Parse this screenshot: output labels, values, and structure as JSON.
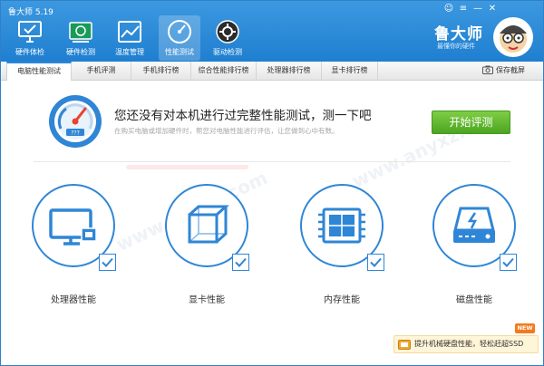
{
  "app": {
    "title": "鲁大师 5.19"
  },
  "window_controls": {
    "skin": "☺",
    "menu": "≡",
    "minimize": "—",
    "close": "✕"
  },
  "nav": [
    {
      "label": "硬件体检",
      "icon": "monitor-check-icon"
    },
    {
      "label": "硬件检测",
      "icon": "circuit-board-icon"
    },
    {
      "label": "温度管理",
      "icon": "temperature-chart-icon"
    },
    {
      "label": "性能测试",
      "icon": "speedometer-icon",
      "active": true
    },
    {
      "label": "驱动检测",
      "icon": "gear-disc-icon"
    }
  ],
  "brand": {
    "name": "鲁大师",
    "slogan": "最懂你的硬件",
    "avatar_icon": "mascot-avatar-icon"
  },
  "tabs": [
    {
      "label": "电脑性能测试",
      "active": true
    },
    {
      "label": "手机评测"
    },
    {
      "label": "手机排行榜"
    },
    {
      "label": "综合性能排行榜"
    },
    {
      "label": "处理器排行榜"
    },
    {
      "label": "显卡排行榜"
    }
  ],
  "screenshot": {
    "label": "保存截屏",
    "icon": "camera-icon"
  },
  "main": {
    "headline": "您还没有对本机进行过完整性能测试，测一下吧",
    "subtext": "在购买电脑或增加硬件时，帮您对电脑性能进行评估，让您做到心中有数。",
    "gauge_readout": "???",
    "start_button": "开始评测"
  },
  "cards": [
    {
      "label": "处理器性能",
      "icon": "cpu-monitor-icon",
      "checked": true
    },
    {
      "label": "显卡性能",
      "icon": "gpu-cube-icon",
      "checked": true
    },
    {
      "label": "内存性能",
      "icon": "memory-chip-icon",
      "checked": true
    },
    {
      "label": "磁盘性能",
      "icon": "hard-disk-icon",
      "checked": true
    }
  ],
  "promo": {
    "text": "提升机械硬盘性能，轻松赶超SSD",
    "badge": "NEW",
    "icon": "ssd-icon"
  },
  "watermark": "www.anyxz.com",
  "colors": {
    "header_blue": "#2a87d4",
    "accent_blue": "#2f86d6",
    "green_button": "#5cb82c",
    "badge_orange": "#f37a1f"
  }
}
